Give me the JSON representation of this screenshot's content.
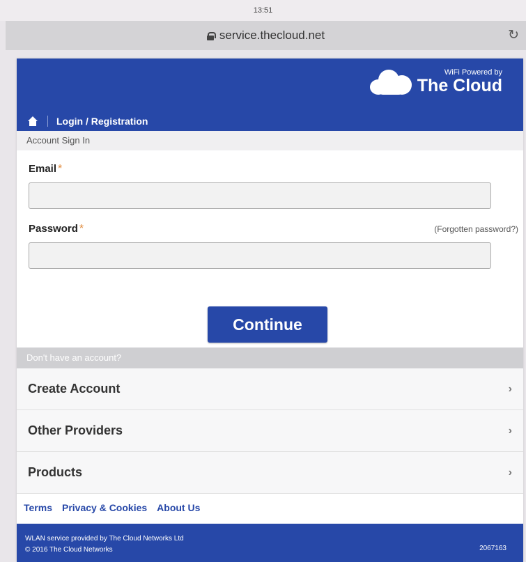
{
  "device": {
    "time": "13:51"
  },
  "browser": {
    "url": "service.thecloud.net",
    "lock_icon": "lock-icon",
    "reload_icon": "reload-icon"
  },
  "header": {
    "brand_small": "WiFi Powered by",
    "brand_big": "The Cloud",
    "nav_label": "Login / Registration"
  },
  "signin": {
    "section_title": "Account Sign In",
    "email_label": "Email",
    "password_label": "Password",
    "required_mark": "*",
    "forgot_link": "(Forgotten password?)",
    "email_value": "",
    "password_value": "",
    "continue_label": "Continue"
  },
  "register": {
    "section_title": "Don't have an account?",
    "items": [
      {
        "label": "Create Account"
      },
      {
        "label": "Other Providers"
      },
      {
        "label": "Products"
      }
    ]
  },
  "links": {
    "terms": "Terms",
    "privacy": "Privacy & Cookies",
    "about": "About Us"
  },
  "footer": {
    "line1": "WLAN service provided by The Cloud Networks Ltd",
    "line2": "© 2016 The Cloud Networks",
    "id": "2067163"
  },
  "colors": {
    "brand_blue": "#2748a8",
    "required": "#e08a3c"
  }
}
